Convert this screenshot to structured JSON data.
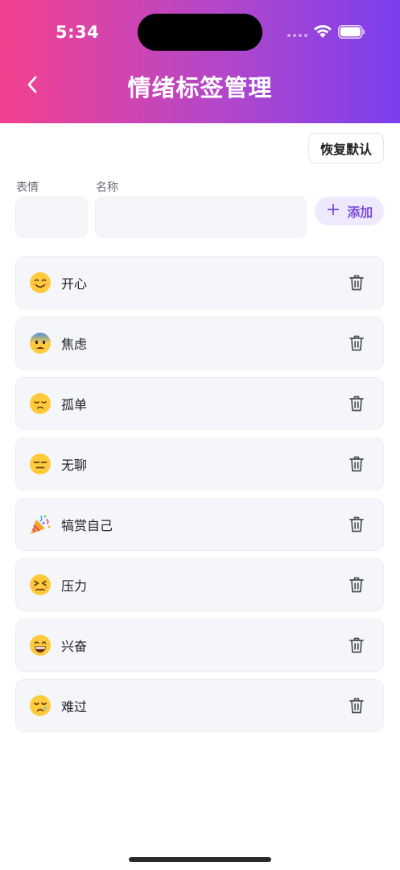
{
  "status_bar": {
    "time": "5:34"
  },
  "header": {
    "title": "情绪标签管理"
  },
  "actions": {
    "reset_label": "恢复默认",
    "add_label": "添加"
  },
  "form": {
    "emoji_label": "表情",
    "name_label": "名称",
    "emoji_value": "",
    "name_value": ""
  },
  "tags": [
    {
      "emoji": "smiling-face-icon",
      "label": "开心"
    },
    {
      "emoji": "anxious-face-icon",
      "label": "焦虑"
    },
    {
      "emoji": "pensive-face-icon",
      "label": "孤单"
    },
    {
      "emoji": "expressionless-face-icon",
      "label": "无聊"
    },
    {
      "emoji": "party-popper-icon",
      "label": "犒赏自己"
    },
    {
      "emoji": "persevering-face-icon",
      "label": "压力"
    },
    {
      "emoji": "grinning-face-icon",
      "label": "兴奋"
    },
    {
      "emoji": "crying-face-icon",
      "label": "难过"
    }
  ],
  "colors": {
    "gradient_start": "#f4418f",
    "gradient_mid": "#b347c9",
    "gradient_end": "#7b3ff0",
    "accent": "#7c4ddc",
    "accent_bg": "#efe9fd",
    "item_bg": "#f5f6fa"
  }
}
